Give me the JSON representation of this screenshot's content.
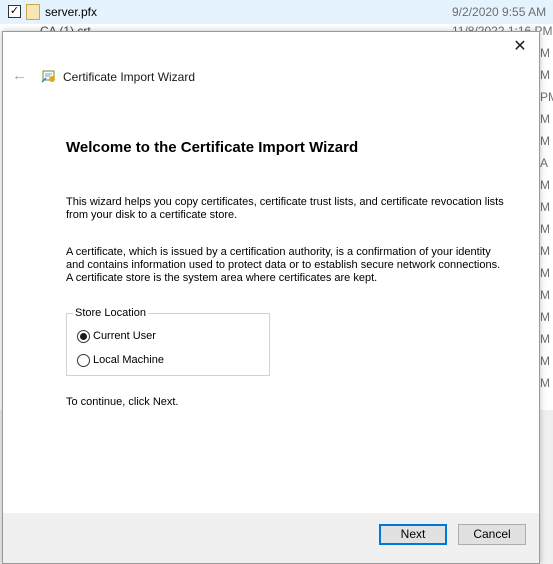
{
  "background": {
    "selected_file": {
      "name": "server.pfx",
      "date": "9/2/2020 9:55 AM"
    },
    "second_file": {
      "name": "CA (1).crt",
      "date": "11/8/2022 1:16 PM"
    },
    "right_fragments": [
      "M",
      "M",
      "PM",
      "M",
      "M",
      "A",
      "M",
      "M",
      "M",
      "M",
      "M",
      "M",
      "M",
      "M",
      "M",
      "M",
      "M"
    ]
  },
  "dialog": {
    "close_glyph": "✕",
    "back_glyph": "←",
    "wizard_title": "Certificate Import Wizard",
    "heading": "Welcome to the Certificate Import Wizard",
    "para1": "This wizard helps you copy certificates, certificate trust lists, and certificate revocation lists from your disk to a certificate store.",
    "para2": "A certificate, which is issued by a certification authority, is a confirmation of your identity and contains information used to protect data or to establish secure network connections. A certificate store is the system area where certificates are kept.",
    "store_location": {
      "legend": "Store Location",
      "options": [
        {
          "label": "Current User",
          "selected": true
        },
        {
          "label": "Local Machine",
          "selected": false
        }
      ]
    },
    "continue_text": "To continue, click Next.",
    "next_label": "Next",
    "cancel_label": "Cancel"
  }
}
